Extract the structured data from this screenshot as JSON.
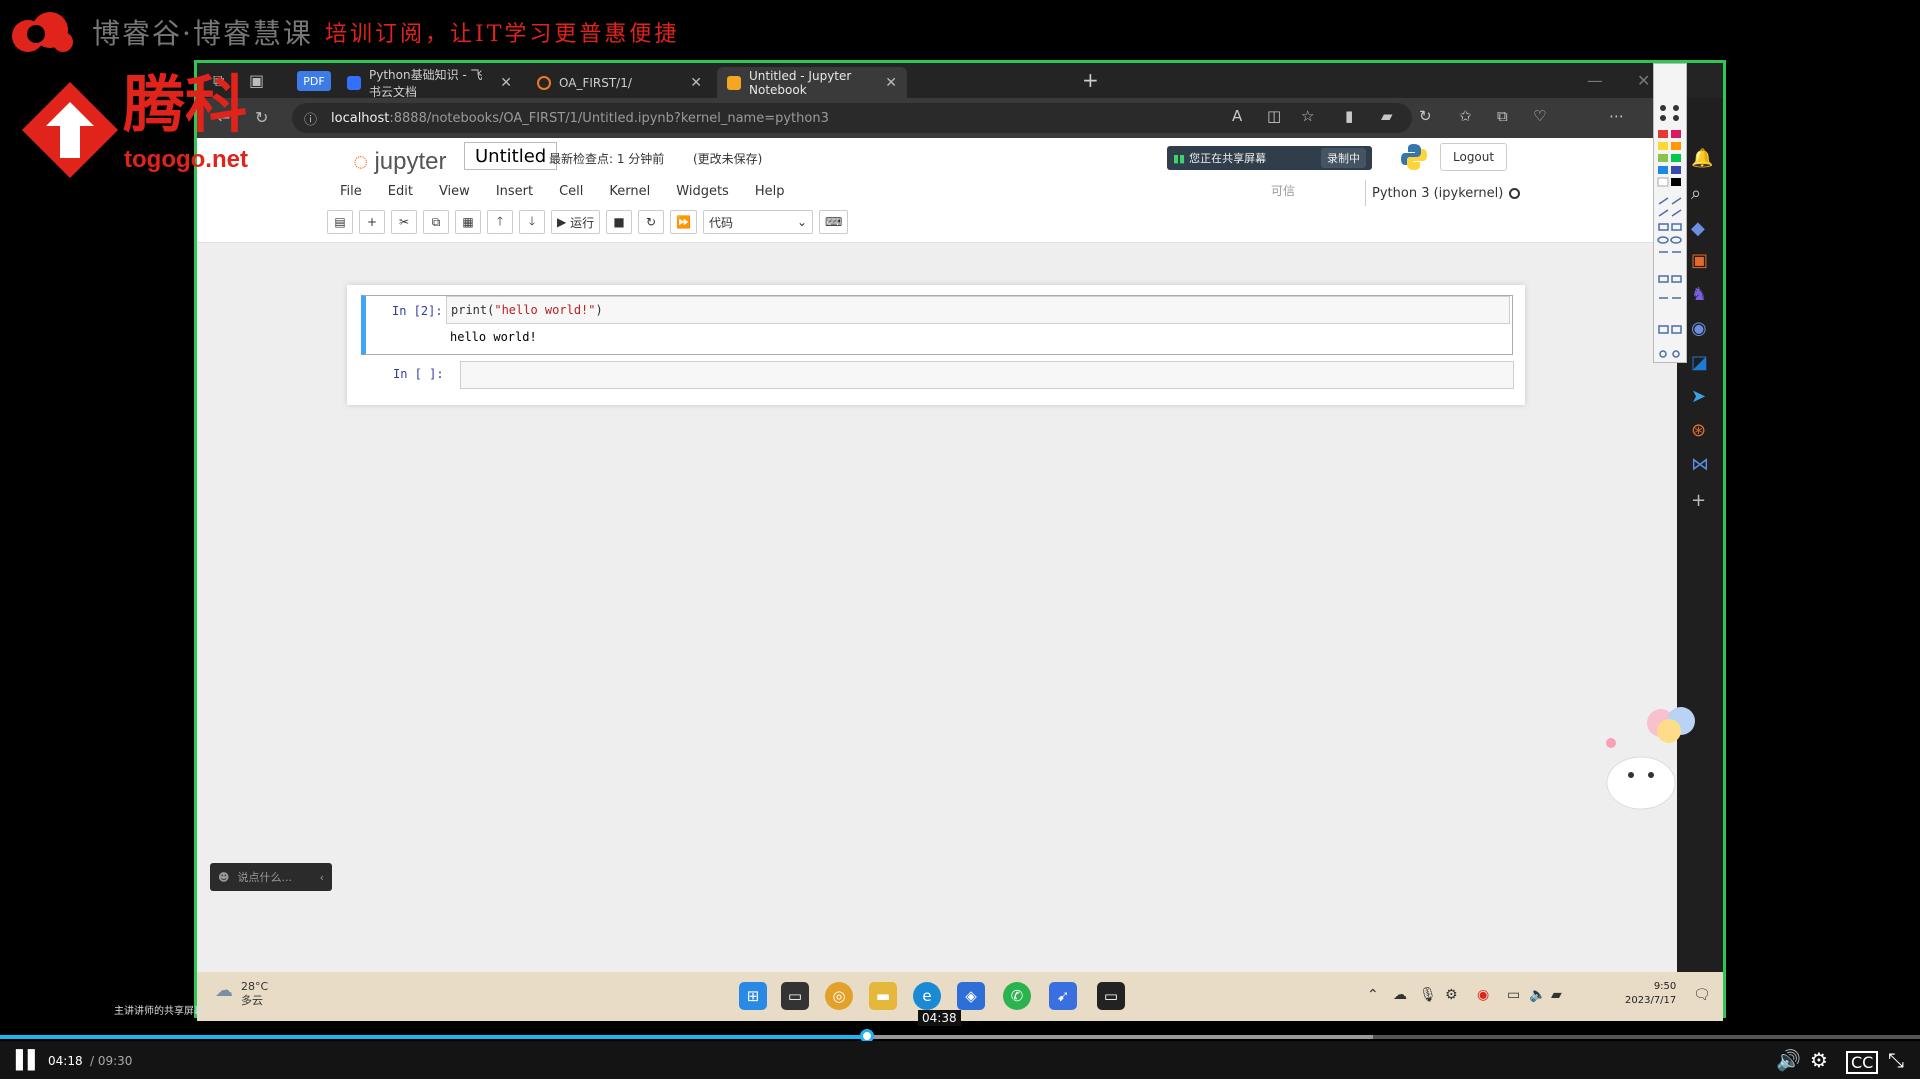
{
  "watermark": {
    "brand": "博睿谷·博睿慧课",
    "slogan": "培训订阅，让IT学习更普惠便捷",
    "tg_name": "腾科",
    "tg_url": "togogo.net"
  },
  "browser": {
    "pdf_badge": "PDF",
    "tabs": [
      {
        "label": "Python基础知识 - 飞书云文档",
        "active": false
      },
      {
        "label": "OA_FIRST/1/",
        "active": false
      },
      {
        "label": "Untitled - Jupyter Notebook",
        "active": true
      }
    ],
    "url_host": "localhost",
    "url_path": ":8888/notebooks/OA_FIRST/1/Untitled.ipynb?kernel_name=python3"
  },
  "jupyter": {
    "logo_text": "jupyter",
    "notebook_title": "Untitled",
    "checkpoint": "最新检查点: 1 分钟前",
    "unsaved": "(更改未保存)",
    "share_status": "您正在共享屏幕",
    "recording": "录制中",
    "logout": "Logout",
    "menu": [
      "File",
      "Edit",
      "View",
      "Insert",
      "Cell",
      "Kernel",
      "Widgets",
      "Help"
    ],
    "trusted": "可信",
    "kernel_name": "Python 3 (ipykernel)",
    "run_label": "运行",
    "cell_type": "代码",
    "cells": [
      {
        "prompt": "In  [2]:",
        "code_fn": "print(",
        "code_str": "\"hello world!\"",
        "code_end": ")",
        "output": "hello world!"
      },
      {
        "prompt": "In  [ ]:",
        "code_fn": "",
        "code_str": "",
        "code_end": "",
        "output": ""
      }
    ]
  },
  "chat": {
    "placeholder": "说点什么..."
  },
  "taskbar": {
    "temperature": "28°C",
    "weather": "多云",
    "time": "9:50",
    "date": "2023/7/17"
  },
  "sharer_label": "主讲讲师的共享屏幕",
  "video": {
    "current_time": "04:18",
    "total_time": "/ 09:30",
    "hover_time": "04:38",
    "played_fraction": 0.4515,
    "buffered_fraction": 0.715
  },
  "colors": {
    "accent": "#1fb3f0",
    "frame": "#2fc654",
    "brand_red": "#e0241c",
    "jupyter_orange": "#f37726"
  }
}
